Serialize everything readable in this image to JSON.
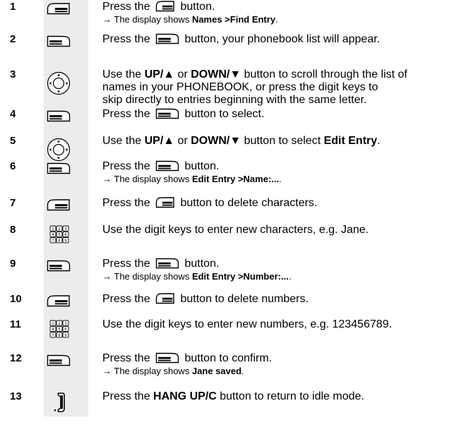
{
  "steps": [
    {
      "num": "1",
      "icon": "right-softkey-icon",
      "lines": [
        [
          {
            "t": "Press the "
          },
          {
            "icon": "right-softkey-icon"
          },
          {
            "t": " button."
          }
        ]
      ],
      "sub": [
        {
          "t": "→ The display shows "
        },
        {
          "t": "Names >Find Entry",
          "b": true
        },
        {
          "t": "."
        }
      ]
    },
    {
      "num": "2",
      "icon": "left-softkey-icon",
      "lines": [
        [
          {
            "t": "Press the "
          },
          {
            "icon": "left-softkey-icon"
          },
          {
            "t": " button, your phonebook list will appear."
          }
        ]
      ]
    },
    {
      "num": "3",
      "icon": "navigation-key-icon",
      "lines": [
        [
          {
            "t": "Use the "
          },
          {
            "t": "UP/▲",
            "b": true
          },
          {
            "t": " or "
          },
          {
            "t": "DOWN/▼",
            "b": true
          },
          {
            "t": " button to scroll through the list of"
          }
        ],
        [
          {
            "t": "names in your PHONEBOOK, or press the digit keys to"
          }
        ],
        [
          {
            "t": "skip directly to entries beginning with the same letter."
          }
        ]
      ]
    },
    {
      "num": "4",
      "icon": "left-softkey-icon",
      "lines": [
        [
          {
            "t": "Press the "
          },
          {
            "icon": "left-softkey-icon"
          },
          {
            "t": " button to select."
          }
        ]
      ]
    },
    {
      "num": "5",
      "icon": "navigation-key-icon",
      "lines": [
        [
          {
            "t": "Use the "
          },
          {
            "t": "UP/▲",
            "b": true
          },
          {
            "t": " or "
          },
          {
            "t": "DOWN/▼",
            "b": true
          },
          {
            "t": " button to select "
          },
          {
            "t": "Edit Entry",
            "b": true
          },
          {
            "t": "."
          }
        ]
      ]
    },
    {
      "num": "6",
      "icon": "left-softkey-icon",
      "lines": [
        [
          {
            "t": "Press the "
          },
          {
            "icon": "left-softkey-icon"
          },
          {
            "t": " button."
          }
        ]
      ],
      "sub": [
        {
          "t": "→ The display shows "
        },
        {
          "t": "Edit Entry >Name:...",
          "b": true
        },
        {
          "t": "."
        }
      ]
    },
    {
      "num": "7",
      "icon": "right-softkey-icon",
      "lines": [
        [
          {
            "t": "Press the "
          },
          {
            "icon": "right-softkey-icon"
          },
          {
            "t": " button to delete characters."
          }
        ]
      ]
    },
    {
      "num": "8",
      "icon": "keypad-icon",
      "lines": [
        [
          {
            "t": "Use the digit keys to enter new characters, e.g. Jane."
          }
        ]
      ]
    },
    {
      "num": "9",
      "icon": "left-softkey-icon",
      "lines": [
        [
          {
            "t": "Press the "
          },
          {
            "icon": "left-softkey-icon"
          },
          {
            "t": " button."
          }
        ]
      ],
      "sub": [
        {
          "t": "→ The display shows "
        },
        {
          "t": "Edit Entry >Number:...",
          "b": true
        },
        {
          "t": "."
        }
      ]
    },
    {
      "num": "10",
      "icon": "right-softkey-icon",
      "lines": [
        [
          {
            "t": "Press the "
          },
          {
            "icon": "right-softkey-icon"
          },
          {
            "t": " button to delete numbers."
          }
        ]
      ]
    },
    {
      "num": "11",
      "icon": "keypad-icon",
      "lines": [
        [
          {
            "t": "Use the digit keys to enter new numbers, e.g. 123456789."
          }
        ]
      ]
    },
    {
      "num": "12",
      "icon": "left-softkey-icon",
      "lines": [
        [
          {
            "t": "Press the "
          },
          {
            "icon": "left-softkey-icon"
          },
          {
            "t": " button to confirm."
          }
        ]
      ],
      "sub": [
        {
          "t": "→ The display shows "
        },
        {
          "t": "Jane saved",
          "b": true
        },
        {
          "t": "."
        }
      ]
    },
    {
      "num": "13",
      "icon": "hang-up-key-icon",
      "lines": [
        [
          {
            "t": "Press the "
          },
          {
            "t": "HANG UP/C",
            "b": true
          },
          {
            "t": " button to return to idle mode."
          }
        ]
      ]
    }
  ],
  "keypad_labels": [
    "1",
    "2",
    "3",
    "4",
    "5",
    "6",
    "7",
    "8",
    "9"
  ]
}
